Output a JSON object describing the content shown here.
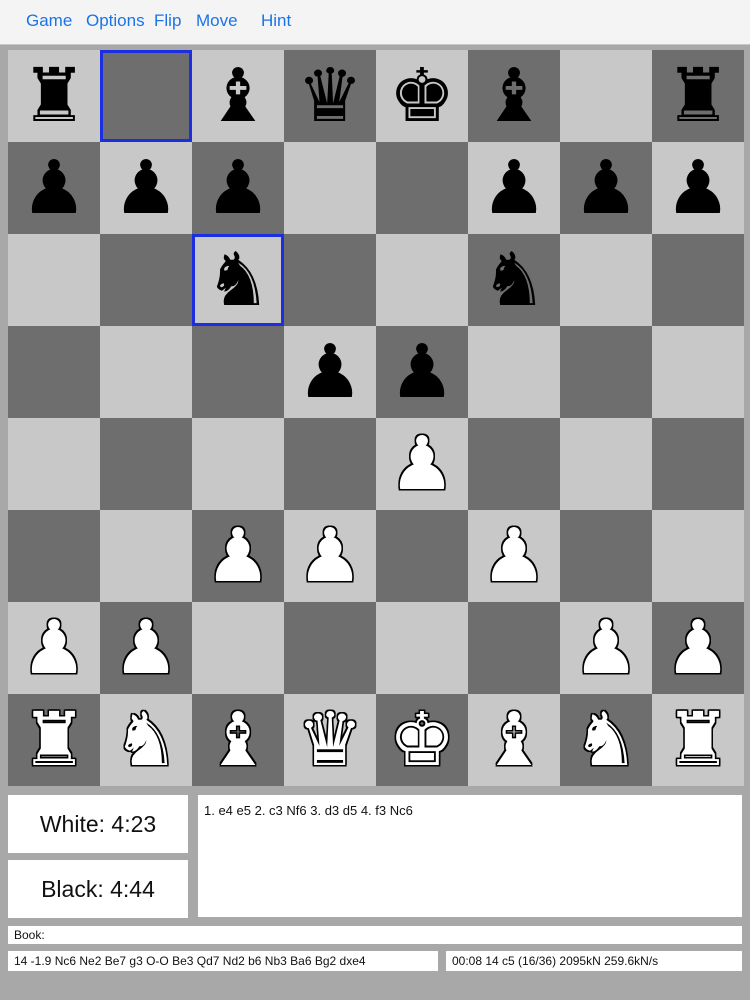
{
  "menu": {
    "game": "Game",
    "options": "Options",
    "flip": "Flip",
    "move": "Move",
    "hint": "Hint"
  },
  "board": {
    "light_color": "#c8c8c8",
    "dark_color": "#6e6e6e",
    "highlight_color": "#1b2fe0",
    "highlighted_squares": [
      "b8",
      "c6"
    ],
    "ranks": [
      "r.bqkb.r",
      "ppp..ppp",
      "..n..n..",
      "...pp...",
      "....P...",
      "..PP.P..",
      "PP....PP",
      "RNBQKBNR"
    ]
  },
  "clocks": {
    "white": "White: 4:23",
    "black": "Black: 4:44"
  },
  "moves": {
    "text": "1. e4 e5 2. c3 Nf6 3. d3 d5 4. f3 Nc6"
  },
  "book": {
    "text": "Book:"
  },
  "engine": {
    "pv": "14 -1.9 Nc6 Ne2 Be7 g3 O-O Be3 Qd7 Nd2 b6 Nb3 Ba6 Bg2 dxe4",
    "stats": "00:08  14  c5 (16/36)  2095kN  259.6kN/s"
  }
}
